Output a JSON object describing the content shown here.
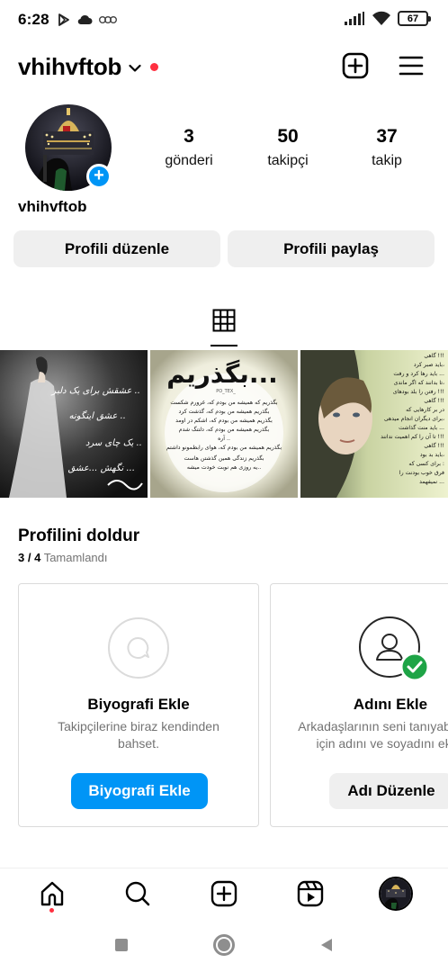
{
  "status_bar": {
    "time": "6:28",
    "battery": "67"
  },
  "header": {
    "username": "vhihvftob"
  },
  "profile": {
    "name": "vhihvftob",
    "stats": [
      {
        "value": "3",
        "label": "gönderi"
      },
      {
        "value": "50",
        "label": "takipçi"
      },
      {
        "value": "37",
        "label": "takip"
      }
    ],
    "edit_button": "Profili düzenle",
    "share_button": "Profili paylaş"
  },
  "posts": {
    "post2_heading": "بگذریم...",
    "post2_tag": "PO_TEX_",
    "post2_lines": [
      "بگذریم که همیشه من بودم که، غرورم شکست",
      "بگذریم همیشه من بودم که، گذشت کرد",
      "بگذریم همیشه من بودم که، اشکم در اومد",
      "بگذریم همیشه من بودم که، دلتنگ شدم",
      "آره ..",
      "بگذریم همیشه من بودم که، هوای رابطمونو داشتم",
      "بگذریم زندگی همین گذشتن هاست",
      "یه روزی هم نوبت خودت میشه.."
    ],
    "post1_lines": [
      "عشقش برای یک دلبر ..",
      "عشق اینگونه ..",
      "یک چای سرد ..",
      "نگهش ...عشق ..."
    ],
    "post3_lines": [
      "گاهی !!!",
      "باید صبر کرد،",
      "باید رها کرد و رفت ...",
      "تا بدانند که اگر ماندی،",
      "رفتن را بلد بودهای !!!",
      "گاهی !!!",
      "در بر کارهایی که",
      "برای دیگران انجام میدهی،",
      "باید منت گذاشت ...",
      "تا آن را کم اهمیت ندانند !!!",
      "گاهی !!!",
      "باید بد بود،",
      "برای کسی که :",
      "فرق خوب بودنت را",
      "نمیفهمد ..."
    ]
  },
  "complete_profile": {
    "title": "Profilini doldur",
    "progress_count": "3 / 4",
    "progress_label": "Tamamlandı",
    "cards": [
      {
        "title": "Biyografi Ekle",
        "desc_line1": "Takipçilerine biraz kendinden",
        "desc_line2": "bahset.",
        "button": "Biyografi Ekle"
      },
      {
        "title": "Adını Ekle",
        "desc_line1": "Arkadaşlarının seni tanıyabilmesi",
        "desc_line2": "için adını ve soyadını ekle.",
        "button": "Adı Düzenle"
      }
    ]
  },
  "bottom_nav": {
    "items": [
      "home-icon",
      "search-icon",
      "create-icon",
      "reels-icon",
      "profile-avatar"
    ]
  },
  "colors": {
    "primary_blue": "#0095f6",
    "notification_red": "#ff3040",
    "success_green": "#1ea446",
    "button_gray": "#efefef",
    "secondary_text": "#737373"
  }
}
